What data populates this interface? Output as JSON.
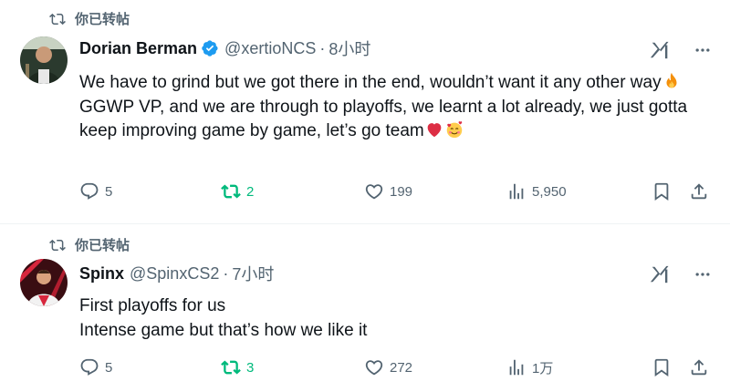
{
  "tweets": [
    {
      "retweet_label": "你已转帖",
      "display_name": "Dorian Berman",
      "verified": true,
      "handle": "@xertioNCS",
      "separator": "·",
      "time": "8小时",
      "text_lines": [
        "We have to grind but we got there in the end, wouldn’t want it any other way",
        "GGWP VP, and we are through to playoffs, we learnt a lot already, we just gotta keep improving game by game, let’s go team"
      ],
      "emojis": [
        "fire",
        "red-heart",
        "smiling-face-with-hearts"
      ],
      "stats": {
        "replies": "5",
        "retweets": "2",
        "likes": "199",
        "views": "5,950"
      }
    },
    {
      "retweet_label": "你已转帖",
      "display_name": "Spinx",
      "verified": false,
      "handle": "@SpinxCS2",
      "separator": "·",
      "time": "7小时",
      "text_lines": [
        "First playoffs for us",
        "Intense game but that’s how we like it"
      ],
      "stats": {
        "replies": "5",
        "retweets": "3",
        "likes": "272",
        "views": "1万"
      }
    }
  ],
  "colors": {
    "text": "#0f1419",
    "muted": "#536471",
    "retweet_active": "#00ba7c",
    "verified_badge": "#1d9bf0",
    "divider": "#eff3f4"
  }
}
